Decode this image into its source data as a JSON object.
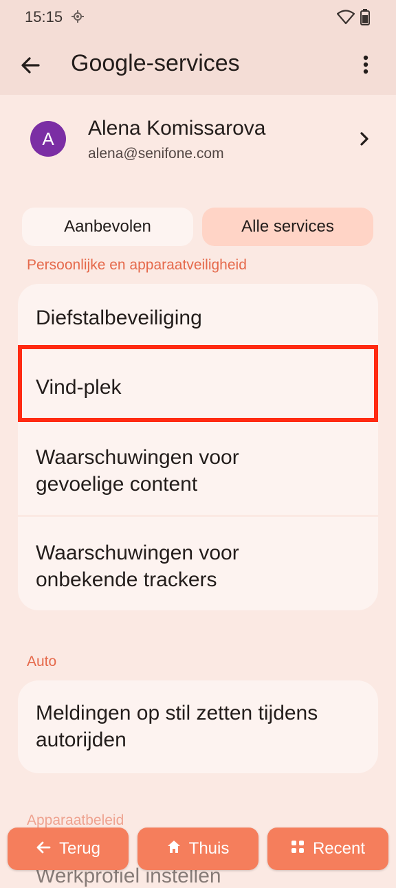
{
  "status": {
    "time": "15:15"
  },
  "appbar": {
    "title": "Google-services"
  },
  "account": {
    "initial": "A",
    "name": "Alena Komissarova",
    "email": "alena@senifone.com",
    "avatar_color": "#7b2ea4"
  },
  "tabs": {
    "recommended": "Aanbevolen",
    "all": "Alle services",
    "selected": "all"
  },
  "sections": [
    {
      "label": "Persoonlijke en apparaatveiligheid",
      "items": [
        {
          "line1": "Diefstalbeveiliging"
        },
        {
          "line1": "Vind-plek",
          "highlighted": true
        },
        {
          "line1": "Waarschuwingen voor",
          "line2": "gevoelige content"
        },
        {
          "line1": "Waarschuwingen voor",
          "line2": "onbekende trackers"
        }
      ]
    },
    {
      "label": "Auto",
      "items": [
        {
          "line1": "Meldingen op stil zetten tijdens",
          "line2": "autorijden"
        }
      ]
    },
    {
      "label": "Apparaatbeleid",
      "items": [
        {
          "line1": "Werkprofiel instellen"
        }
      ]
    }
  ],
  "navbar": {
    "back": "Terug",
    "home": "Thuis",
    "recent": "Recent"
  },
  "colors": {
    "accent": "#f57e5c",
    "section_label": "#e5694b",
    "highlight": "#ff2a12"
  }
}
